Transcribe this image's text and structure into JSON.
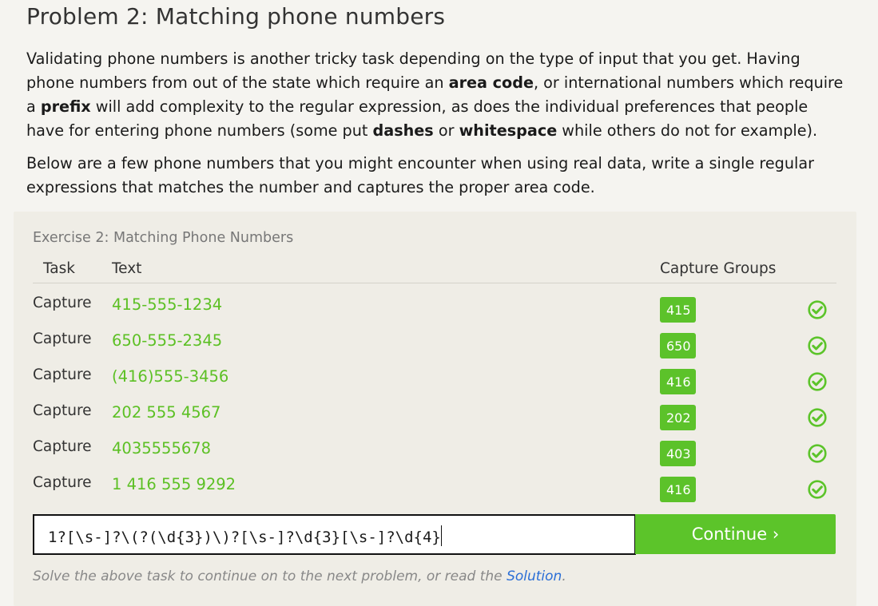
{
  "page": {
    "title": "Problem 2: Matching phone numbers"
  },
  "intro": {
    "p1_a": "Validating phone numbers is another tricky task depending on the type of input that you get. Having phone numbers from out of the state which require an ",
    "p1_b1": "area code",
    "p1_c": ", or international numbers which require a ",
    "p1_b2": "prefix",
    "p1_d": " will add complexity to the regular expression, as does the individual preferences that people have for entering phone numbers (some put ",
    "p1_b3": "dashes",
    "p1_e": " or ",
    "p1_b4": "whitespace",
    "p1_f": " while others do not for example).",
    "p2": "Below are a few phone numbers that you might encounter when using real data, write a single regular expressions that matches the number and captures the proper area code."
  },
  "exercise": {
    "title": "Exercise 2: Matching Phone Numbers",
    "headers": {
      "task": "Task",
      "text": "Text",
      "capture_groups": "Capture Groups"
    },
    "rows": [
      {
        "task": "Capture",
        "text": "415-555-1234",
        "group": "415"
      },
      {
        "task": "Capture",
        "text": "650-555-2345",
        "group": "650"
      },
      {
        "task": "Capture",
        "text": "(416)555-3456",
        "group": "416"
      },
      {
        "task": "Capture",
        "text": "202 555 4567",
        "group": "202"
      },
      {
        "task": "Capture",
        "text": "4035555678",
        "group": "403"
      },
      {
        "task": "Capture",
        "text": "1 416 555 9292",
        "group": "416"
      }
    ],
    "input_value": "1?[\\s-]?\\(?(\\d{3})\\)?[\\s-]?\\d{3}[\\s-]?\\d{4}",
    "continue_label": "Continue ›",
    "hint_text": "Solve the above task to continue on to the next problem, or read the ",
    "hint_link": "Solution",
    "hint_end": "."
  },
  "colors": {
    "accent_green": "#5cc42a",
    "text_green": "#5cc024",
    "link_blue": "#2a6ed6"
  },
  "icons": {
    "row_status": "check-circle-icon"
  }
}
